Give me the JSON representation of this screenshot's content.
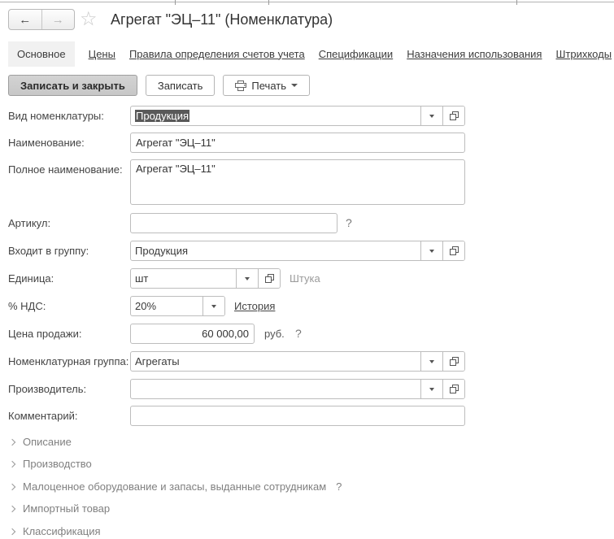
{
  "window": {
    "title": "Агрегат \"ЭЦ–11\" (Номенклатура)"
  },
  "tabs": [
    {
      "label": "Основное",
      "active": true
    },
    {
      "label": "Цены"
    },
    {
      "label": "Правила определения счетов учета"
    },
    {
      "label": "Спецификации"
    },
    {
      "label": "Назначения использования"
    },
    {
      "label": "Штрихкоды"
    }
  ],
  "toolbar": {
    "save_close_label": "Записать и закрыть",
    "save_label": "Записать",
    "print_label": "Печать"
  },
  "form": {
    "fields": {
      "kind": {
        "label": "Вид номенклатуры:",
        "value": "Продукция"
      },
      "name": {
        "label": "Наименование:",
        "value": "Агрегат \"ЭЦ–11\""
      },
      "full_name": {
        "label": "Полное наименование:",
        "value": "Агрегат \"ЭЦ–11\""
      },
      "article": {
        "label": "Артикул:",
        "value": "",
        "help": "?"
      },
      "group": {
        "label": "Входит в группу:",
        "value": "Продукция"
      },
      "unit": {
        "label": "Единица:",
        "value": "шт",
        "hint": "Штука"
      },
      "vat": {
        "label": "% НДС:",
        "value": "20%",
        "link": "История"
      },
      "price": {
        "label": "Цена продажи:",
        "value": "60 000,00",
        "suffix": "руб.",
        "help": "?"
      },
      "nom_group": {
        "label": "Номенклатурная группа:",
        "value": "Агрегаты"
      },
      "manufacturer": {
        "label": "Производитель:",
        "value": ""
      },
      "comment": {
        "label": "Комментарий:",
        "value": ""
      }
    },
    "sections": [
      {
        "label": "Описание"
      },
      {
        "label": "Производство"
      },
      {
        "label": "Малоценное оборудование и запасы, выданные сотрудникам",
        "help": "?"
      },
      {
        "label": "Импортный товар"
      },
      {
        "label": "Классификация"
      }
    ]
  }
}
